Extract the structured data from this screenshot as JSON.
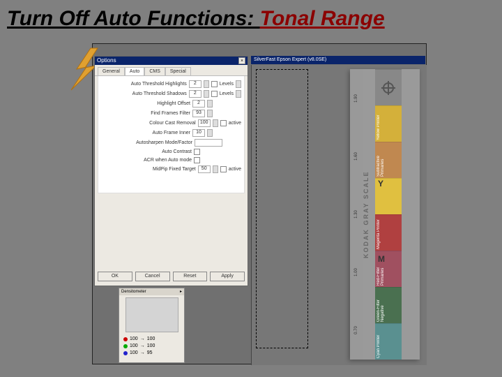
{
  "slide": {
    "title_black": "Turn Off Auto Functions: ",
    "title_red": "Tonal Range"
  },
  "options_dialog": {
    "title": "Options",
    "tabs": {
      "general": "General",
      "auto": "Auto",
      "cms": "CMS",
      "special": "Special"
    },
    "rows": {
      "auto_thresh_hi": {
        "label": "Auto Threshold Highlights",
        "value": "2",
        "check_label": "Levels"
      },
      "auto_thresh_sh": {
        "label": "Auto Threshold Shadows",
        "value": "2",
        "check_label": "Levels"
      },
      "highlight_offset": {
        "label": "Highlight Offset",
        "value": "2"
      },
      "find_frames": {
        "label": "Find Frames Filter",
        "value": "93"
      },
      "color_cast": {
        "label": "Colour Cast Removal",
        "value": "100",
        "check_label": "active"
      },
      "auto_frame": {
        "label": "Auto Frame Inner",
        "value": "10"
      },
      "autosharpen": {
        "label": "Autosharpen Mode/Factor"
      },
      "auto_contrast": {
        "label": "Auto Contrast"
      },
      "acr_auto": {
        "label": "ACR when Auto mode"
      },
      "midpip": {
        "label": "MidPip Fixed Target",
        "value": "50",
        "check_label": "active"
      }
    },
    "buttons": {
      "ok": "OK",
      "cancel": "Cancel",
      "reset": "Reset",
      "apply": "Apply"
    }
  },
  "densitometer": {
    "title": "Densitometer",
    "rows": {
      "r": {
        "val": "100",
        "out": "100"
      },
      "g": {
        "val": "100",
        "out": "100"
      },
      "b": {
        "val": "100",
        "out": "95"
      }
    }
  },
  "scanner_titlebar": "SilverFast Epson Expert (v8.0SE)",
  "colorbar": {
    "label": "KODAK GRAY SCALE",
    "density": [
      "1.90",
      "1.60",
      "1.30",
      "1.00",
      "0.70"
    ],
    "patches": {
      "yellow": "Yellow Printer",
      "orange": "Subtractive Primaries",
      "red": "Magenta Printer",
      "magenta": "Red-Filter Primaries",
      "green": "Green-Filter Negative",
      "teal": "Cyan Printer"
    },
    "letters": {
      "y": "Y",
      "m": "M"
    }
  }
}
